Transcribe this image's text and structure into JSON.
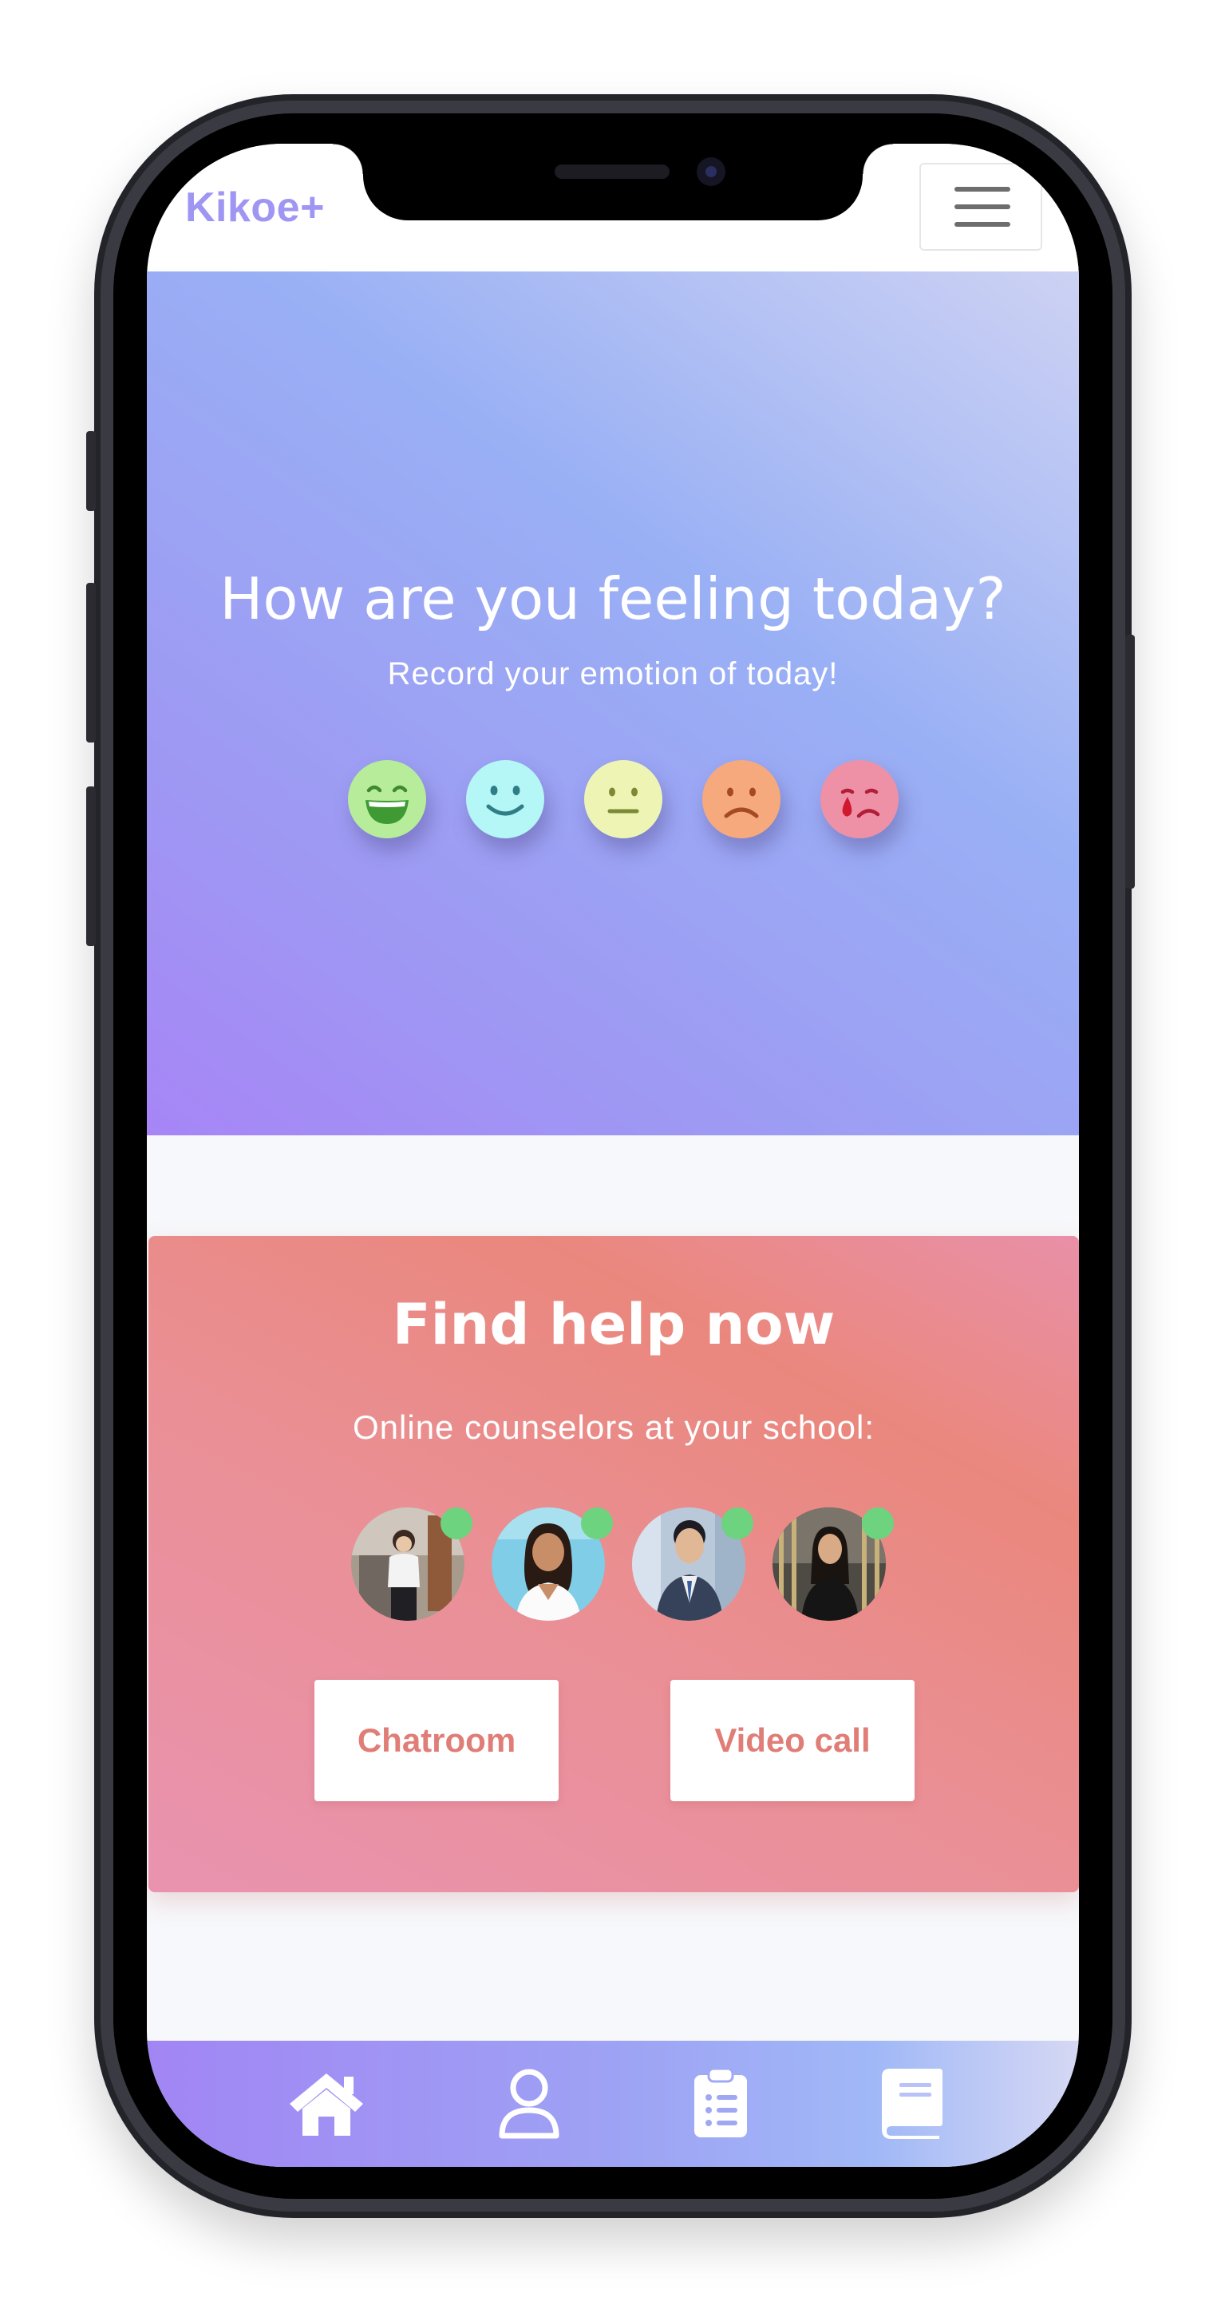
{
  "header": {
    "brand": "Kikoe+",
    "menu_icon": "hamburger-icon"
  },
  "hero": {
    "title": "How are you feeling today?",
    "subtitle": "Record your emotion of today!",
    "moods": [
      {
        "icon": "grinning-face-icon",
        "color": "#b7ec9a"
      },
      {
        "icon": "smiling-face-icon",
        "color": "#b5f6f6"
      },
      {
        "icon": "neutral-face-icon",
        "color": "#eef5b4"
      },
      {
        "icon": "frowning-face-icon",
        "color": "#f6a97c"
      },
      {
        "icon": "crying-face-icon",
        "color": "#ee90a6"
      }
    ]
  },
  "help": {
    "title": "Find help now",
    "subtitle": "Online counselors at your school:",
    "counselors": [
      {
        "status": "online"
      },
      {
        "status": "online"
      },
      {
        "status": "online"
      },
      {
        "status": "online"
      }
    ],
    "chat_label": "Chatroom",
    "video_label": "Video call",
    "button_text_color": "#e07d77",
    "online_color": "#6dd37e"
  },
  "tabbar": {
    "tabs": [
      {
        "icon": "home-icon"
      },
      {
        "icon": "user-icon"
      },
      {
        "icon": "clipboard-list-icon"
      },
      {
        "icon": "book-icon"
      }
    ]
  }
}
